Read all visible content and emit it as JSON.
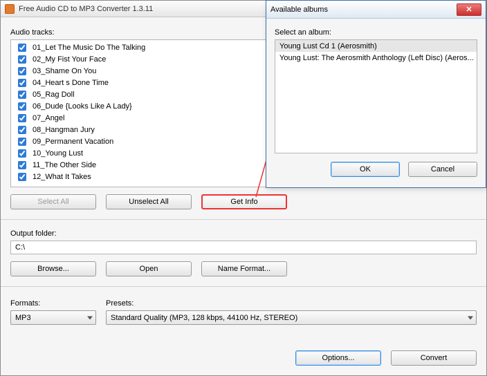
{
  "main": {
    "title": "Free Audio CD to MP3 Converter 1.3.11",
    "tracks_label": "Audio tracks:",
    "tracks": [
      {
        "label": "01_Let The Music Do The Talking",
        "checked": true
      },
      {
        "label": "02_My Fist Your Face",
        "checked": true
      },
      {
        "label": "03_Shame On You",
        "checked": true
      },
      {
        "label": "04_Heart s Done Time",
        "checked": true
      },
      {
        "label": "05_Rag Doll",
        "checked": true
      },
      {
        "label": "06_Dude {Looks Like A Lady}",
        "checked": true
      },
      {
        "label": "07_Angel",
        "checked": true
      },
      {
        "label": "08_Hangman Jury",
        "checked": true
      },
      {
        "label": "09_Permanent Vacation",
        "checked": true
      },
      {
        "label": "10_Young Lust",
        "checked": true
      },
      {
        "label": "11_The Other Side",
        "checked": true
      },
      {
        "label": "12_What It Takes",
        "checked": true
      }
    ],
    "buttons": {
      "select_all": "Select All",
      "unselect_all": "Unselect All",
      "get_info": "Get Info"
    },
    "output_label": "Output folder:",
    "output_value": "C:\\",
    "browse": "Browse...",
    "open": "Open",
    "name_format": "Name Format...",
    "formats_label": "Formats:",
    "format_value": "MP3",
    "presets_label": "Presets:",
    "preset_value": "Standard Quality (MP3, 128 kbps, 44100 Hz, STEREO)",
    "options": "Options...",
    "convert": "Convert"
  },
  "dialog": {
    "title": "Available albums",
    "select_label": "Select an album:",
    "albums": [
      "Young Lust Cd 1 (Aerosmith)",
      "Young Lust: The Aerosmith Anthology (Left Disc) (Aeros..."
    ],
    "selected_index": 0,
    "ok": "OK",
    "cancel": "Cancel"
  }
}
